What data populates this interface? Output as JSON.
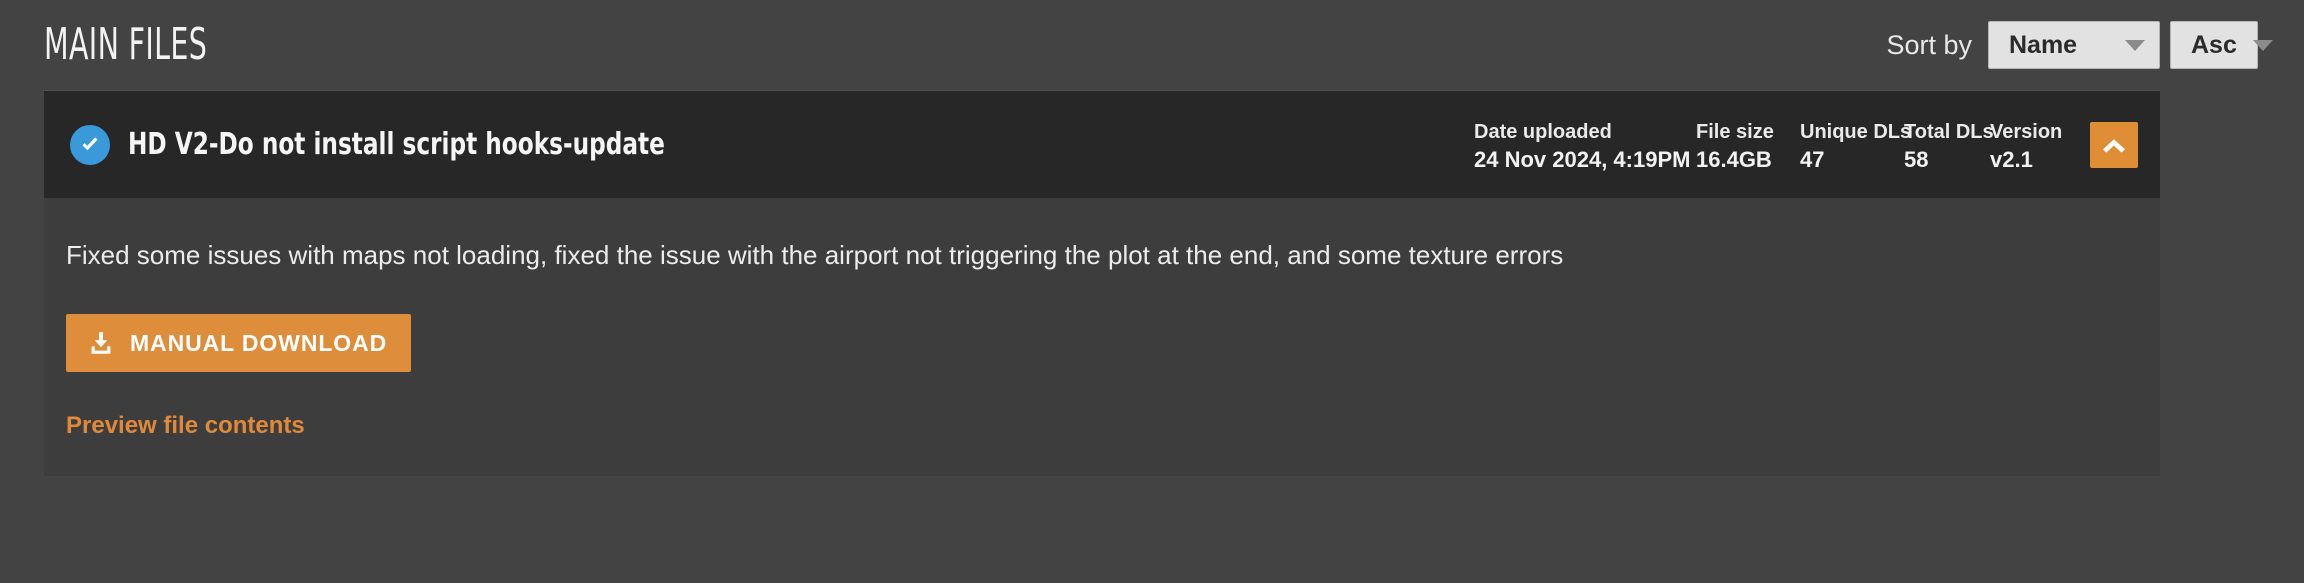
{
  "header": {
    "title": "MAIN FILES",
    "sort": {
      "label": "Sort by",
      "field_value": "Name",
      "direction_value": "Asc",
      "caret_icon": "chevron-down-icon"
    }
  },
  "file": {
    "verified_icon": "check-circle-icon",
    "name": "HD V2-Do not install script hooks-update",
    "collapse_icon": "chevron-up-icon",
    "meta": [
      {
        "label": "Date uploaded",
        "value": "24 Nov 2024, 4:19PM"
      },
      {
        "label": "File size",
        "value": "16.4GB"
      },
      {
        "label": "Unique DLs",
        "value": "47"
      },
      {
        "label": "Total DLs",
        "value": "58"
      },
      {
        "label": "Version",
        "value": "v2.1"
      }
    ],
    "changelog": "Fixed some issues with maps not loading, fixed the issue with the airport not triggering the plot at the end, and some texture errors",
    "download_button": {
      "label": "MANUAL DOWNLOAD",
      "icon": "download-icon"
    },
    "preview_link": "Preview file contents"
  },
  "colors": {
    "page_background": "#434343",
    "card_header_background": "#272727",
    "card_body_background": "#3d3d3d",
    "accent_orange": "#de8e3b",
    "verified_blue": "#3a9ad9",
    "select_background": "#e2e2e2"
  }
}
